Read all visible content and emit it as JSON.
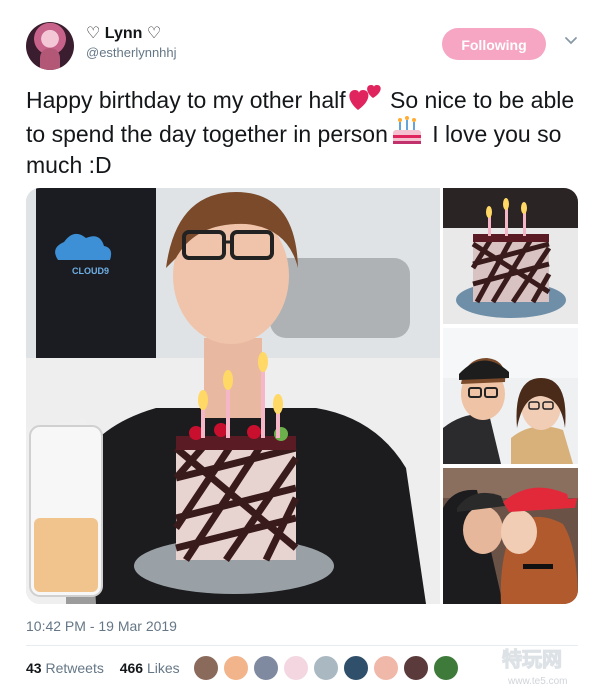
{
  "tweet": {
    "display_name": "♡ Lynn ♡",
    "handle": "@estherlynnhhj",
    "follow_label": "Following",
    "text_1": "Happy birthday to my other half",
    "text_2": "So nice to be able to spend the day together in person",
    "text_3": "I love you so much :D",
    "timestamp": "10:42 PM - 19 Mar 2019",
    "retweets_count": "43",
    "retweets_label": "Retweets",
    "likes_count": "466",
    "likes_label": "Likes"
  },
  "media": {
    "jersey_text": "CLOUD9"
  },
  "watermark": {
    "text": "特玩网",
    "url": "www.te5.com"
  },
  "colors": {
    "follow_button": "#f6a6c2",
    "secondary_text": "#657786",
    "primary_text": "#14171a"
  },
  "icons": [
    "two-hearts-emoji-icon",
    "birthday-cake-emoji-icon",
    "chevron-down-icon"
  ]
}
